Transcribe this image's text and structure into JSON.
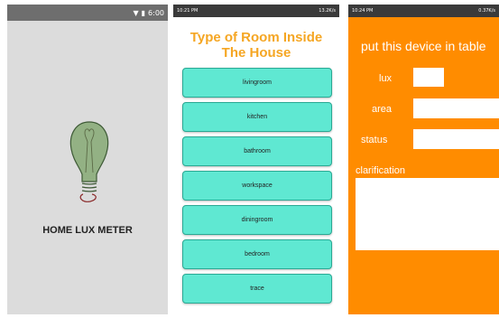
{
  "screen1": {
    "status_time": "6:00",
    "app_title": "HOME LUX METER",
    "logo_icon": "lightbulb-icon"
  },
  "screen2": {
    "status_time": "10:21 PM",
    "status_right": "13.2K/s",
    "title_line1": "Type of Room Inside",
    "title_line2": "The House",
    "rooms": [
      "livingroom",
      "kitchen",
      "bathroom",
      "workspace",
      "diningroom",
      "bedroom",
      "trace"
    ],
    "accent_color": "#f5a623",
    "button_color": "#5fe8d2"
  },
  "screen3": {
    "status_time": "10:24 PM",
    "status_right": "0.37K/s",
    "heading": "put this device in table",
    "labels": {
      "lux": "lux",
      "area": "area",
      "status": "status",
      "clarification": "clarification"
    },
    "values": {
      "lux": "",
      "area": "",
      "status": "",
      "clarification": ""
    },
    "background_color": "#ff8c00"
  }
}
